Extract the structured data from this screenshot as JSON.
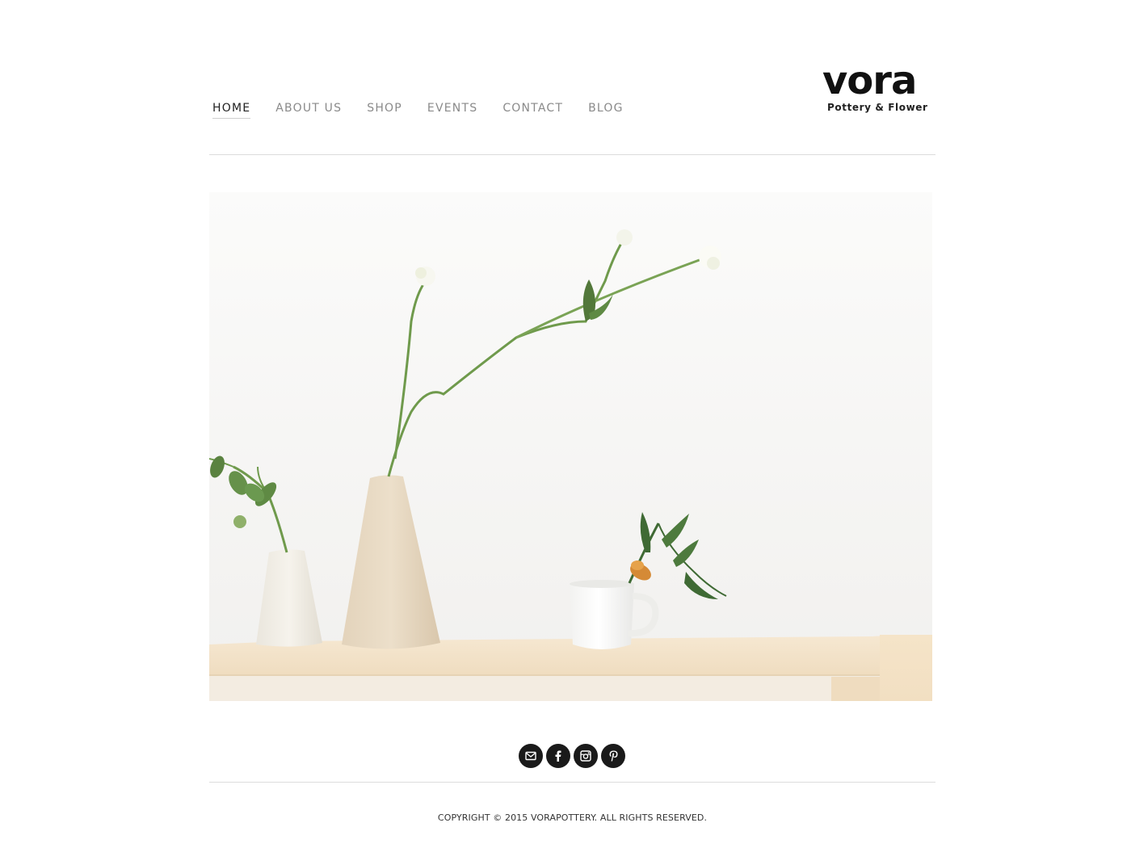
{
  "nav": {
    "items": [
      {
        "label": "HOME",
        "active": true
      },
      {
        "label": "ABOUT US",
        "active": false
      },
      {
        "label": "SHOP",
        "active": false
      },
      {
        "label": "EVENTS",
        "active": false
      },
      {
        "label": "CONTACT",
        "active": false
      },
      {
        "label": "BLOG",
        "active": false
      }
    ]
  },
  "logo": {
    "word": "vora",
    "tagline": "Pottery & Flower"
  },
  "hero": {
    "image": "photo-of-ceramic-vases-with-flowers-on-wooden-shelf"
  },
  "social": {
    "icons": [
      "mail-icon",
      "facebook-icon",
      "instagram-icon",
      "pinterest-icon"
    ]
  },
  "footer": {
    "copyright": "COPYRIGHT © 2015 VORAPOTTERY. ALL RIGHTS RESERVED."
  },
  "colors": {
    "nav_active": "#222222",
    "nav_inactive": "#8a8a8a",
    "divider": "#dcdcdc",
    "social_bg": "#1a1a1a"
  }
}
